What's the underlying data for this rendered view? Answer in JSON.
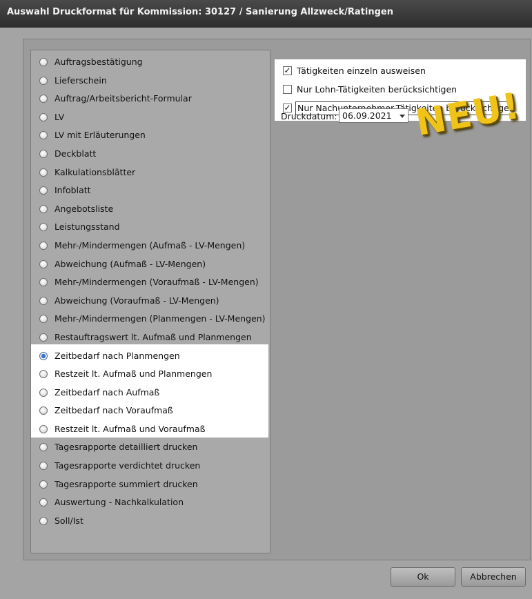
{
  "window": {
    "title": "Auswahl Druckformat für Kommission: 30127 / Sanierung Allzweck/Ratingen"
  },
  "print_formats": [
    {
      "label": "Auftragsbestätigung",
      "selected": false
    },
    {
      "label": "Lieferschein",
      "selected": false
    },
    {
      "label": "Auftrag/Arbeitsbericht-Formular",
      "selected": false
    },
    {
      "label": "LV",
      "selected": false
    },
    {
      "label": "LV mit Erläuterungen",
      "selected": false
    },
    {
      "label": "Deckblatt",
      "selected": false
    },
    {
      "label": "Kalkulationsblätter",
      "selected": false
    },
    {
      "label": "Infoblatt",
      "selected": false
    },
    {
      "label": "Angebotsliste",
      "selected": false
    },
    {
      "label": "Leistungsstand",
      "selected": false
    },
    {
      "label": "Mehr-/Mindermengen (Aufmaß - LV-Mengen)",
      "selected": false
    },
    {
      "label": "Abweichung (Aufmaß - LV-Mengen)",
      "selected": false
    },
    {
      "label": "Mehr-/Mindermengen (Voraufmaß - LV-Mengen)",
      "selected": false
    },
    {
      "label": "Abweichung (Voraufmaß - LV-Mengen)",
      "selected": false
    },
    {
      "label": "Mehr-/Mindermengen (Planmengen - LV-Mengen)",
      "selected": false
    },
    {
      "label": "Restauftragswert lt. Aufmaß und Planmengen",
      "selected": false
    },
    {
      "label": "Zeitbedarf nach Planmengen",
      "selected": true
    },
    {
      "label": "Restzeit lt. Aufmaß und Planmengen",
      "selected": false
    },
    {
      "label": "Zeitbedarf nach Aufmaß",
      "selected": false
    },
    {
      "label": "Zeitbedarf nach Voraufmaß",
      "selected": false
    },
    {
      "label": "Restzeit lt. Aufmaß und Voraufmaß",
      "selected": false
    },
    {
      "label": "Tagesrapporte detailliert drucken",
      "selected": false
    },
    {
      "label": "Tagesrapporte verdichtet drucken",
      "selected": false
    },
    {
      "label": "Tagesrapporte summiert drucken",
      "selected": false
    },
    {
      "label": "Auswertung - Nachkalkulation",
      "selected": false
    },
    {
      "label": "Soll/Ist",
      "selected": false
    }
  ],
  "options": [
    {
      "label": "Tätigkeiten einzeln ausweisen",
      "checked": true
    },
    {
      "label": "Nur Lohn-Tätigkeiten berücksichtigen",
      "checked": false
    },
    {
      "label": "Nur Nachunternehmer-Tätigkeiten berücksichtigen",
      "checked": true
    }
  ],
  "print_date": {
    "label": "Druckdatum:",
    "value": "06.09.2021"
  },
  "badge": "NEU!",
  "buttons": {
    "ok": "Ok",
    "cancel": "Abbrechen"
  }
}
